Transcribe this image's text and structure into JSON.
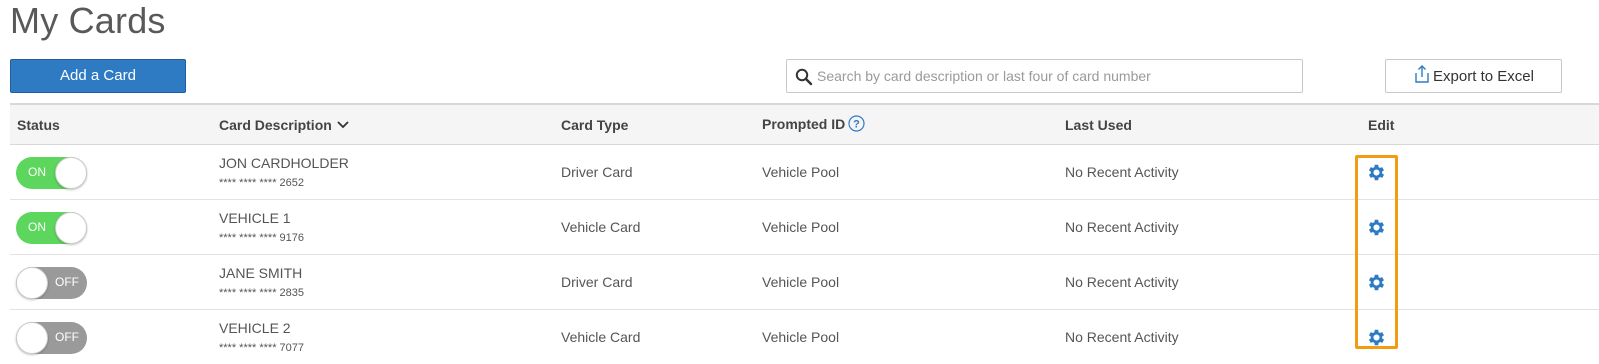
{
  "page": {
    "title": "My Cards"
  },
  "toolbar": {
    "add_label": "Add a Card",
    "search_placeholder": "Search by card description or last four of card number",
    "search_value": "",
    "export_label": "Export to Excel"
  },
  "table": {
    "headers": {
      "status": "Status",
      "description": "Card Description",
      "card_type": "Card Type",
      "prompted_id": "Prompted ID",
      "last_used": "Last Used",
      "edit": "Edit"
    },
    "rows": [
      {
        "status": "ON",
        "name": "JON CARDHOLDER",
        "number": "**** **** **** 2652",
        "card_type": "Driver Card",
        "prompted_id": "Vehicle Pool",
        "last_used": "No Recent Activity"
      },
      {
        "status": "ON",
        "name": "VEHICLE 1",
        "number": "**** **** **** 9176",
        "card_type": "Vehicle Card",
        "prompted_id": "Vehicle Pool",
        "last_used": "No Recent Activity"
      },
      {
        "status": "OFF",
        "name": "JANE SMITH",
        "number": "**** **** **** 2835",
        "card_type": "Driver Card",
        "prompted_id": "Vehicle Pool",
        "last_used": "No Recent Activity"
      },
      {
        "status": "OFF",
        "name": "VEHICLE 2",
        "number": "**** **** **** 7077",
        "card_type": "Vehicle Card",
        "prompted_id": "Vehicle Pool",
        "last_used": "No Recent Activity"
      }
    ]
  },
  "colors": {
    "primary_button": "#2e7bc4",
    "toggle_on": "#5cd65c",
    "toggle_off": "#9a9a9a",
    "gear": "#2e7bc4",
    "highlight": "#f39c12"
  },
  "icons": {
    "search": "search-icon",
    "export": "export-icon",
    "sort": "chevron-down-icon",
    "help": "help-icon",
    "edit": "gear-icon"
  }
}
